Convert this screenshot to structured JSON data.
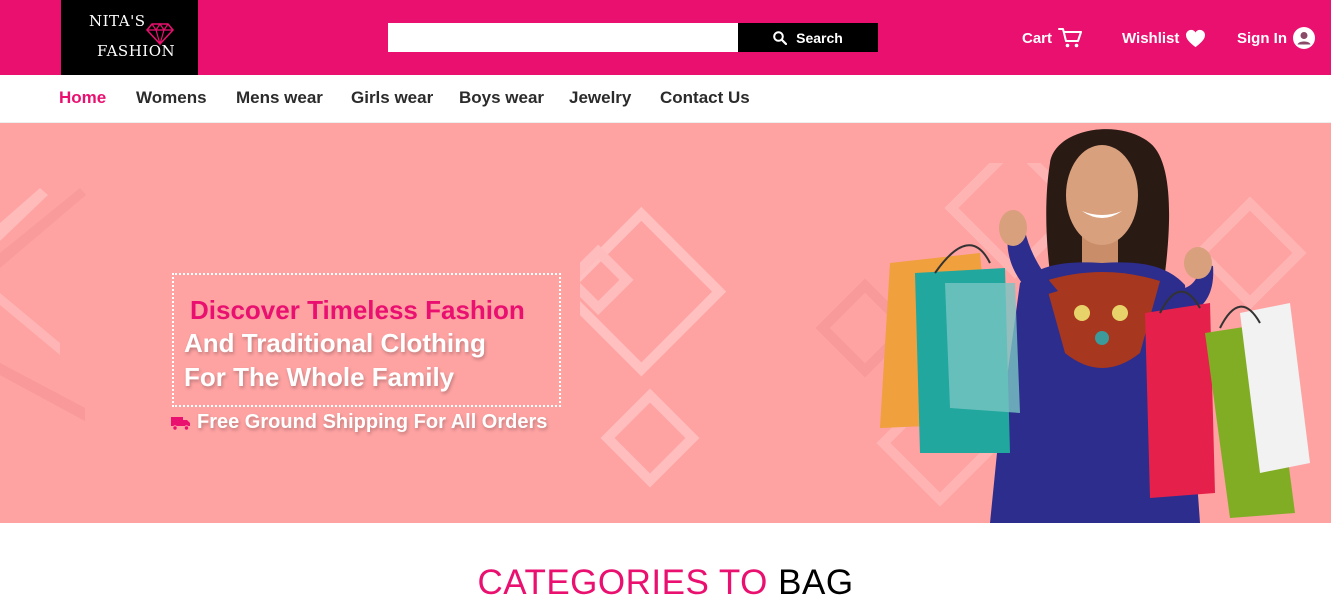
{
  "brand": {
    "logo_line1": "NITA'S",
    "logo_line2": "FASHION",
    "color": "#ea1070"
  },
  "header": {
    "search": {
      "placeholder": "",
      "value": "",
      "button_label": "Search",
      "icon": "search-icon"
    },
    "actions": [
      {
        "label": "Cart",
        "icon": "cart-icon"
      },
      {
        "label": "Wishlist",
        "icon": "heart-icon"
      },
      {
        "label": "Sign In",
        "icon": "user-icon"
      }
    ]
  },
  "nav": {
    "active": "Home",
    "items": [
      "Home",
      "Womens",
      "Mens wear",
      "Girls wear",
      "Boys wear",
      "Jewelry",
      "Contact Us"
    ]
  },
  "hero": {
    "headline_line1": "Discover Timeless Fashion",
    "headline_line2": "And Traditional Clothing",
    "headline_line3": "For The Whole Family",
    "shipping_text": "Free Ground Shipping For All Orders",
    "shipping_icon": "truck-icon",
    "background": "#fea2a2"
  },
  "categories": {
    "title_part1": "CATEGORIES TO",
    "title_part2": "BAG"
  }
}
